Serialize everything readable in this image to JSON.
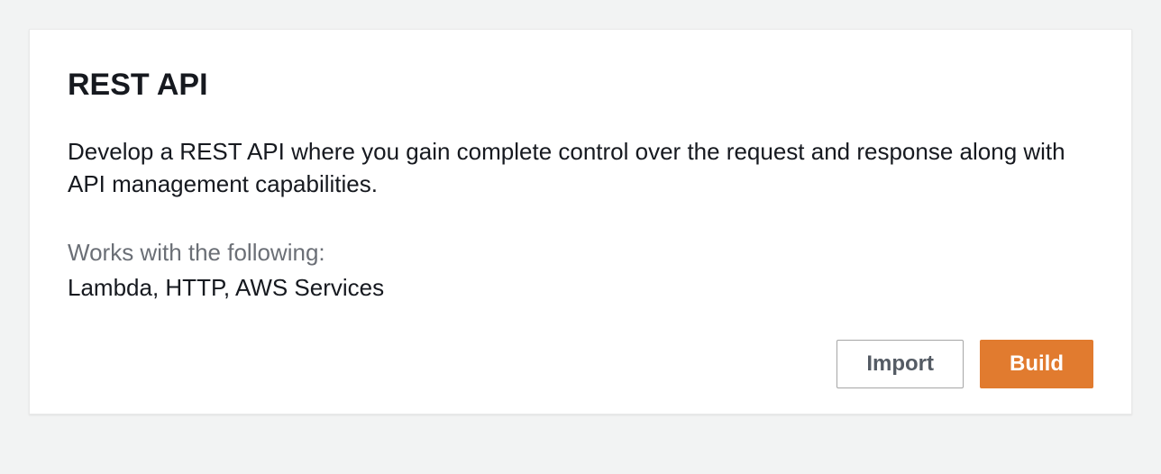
{
  "card": {
    "title": "REST API",
    "description": "Develop a REST API where you gain complete control over the request and response along with API management capabilities.",
    "works_with_label": "Works with the following:",
    "works_with_value": "Lambda, HTTP, AWS Services",
    "buttons": {
      "import": "Import",
      "build": "Build"
    }
  }
}
